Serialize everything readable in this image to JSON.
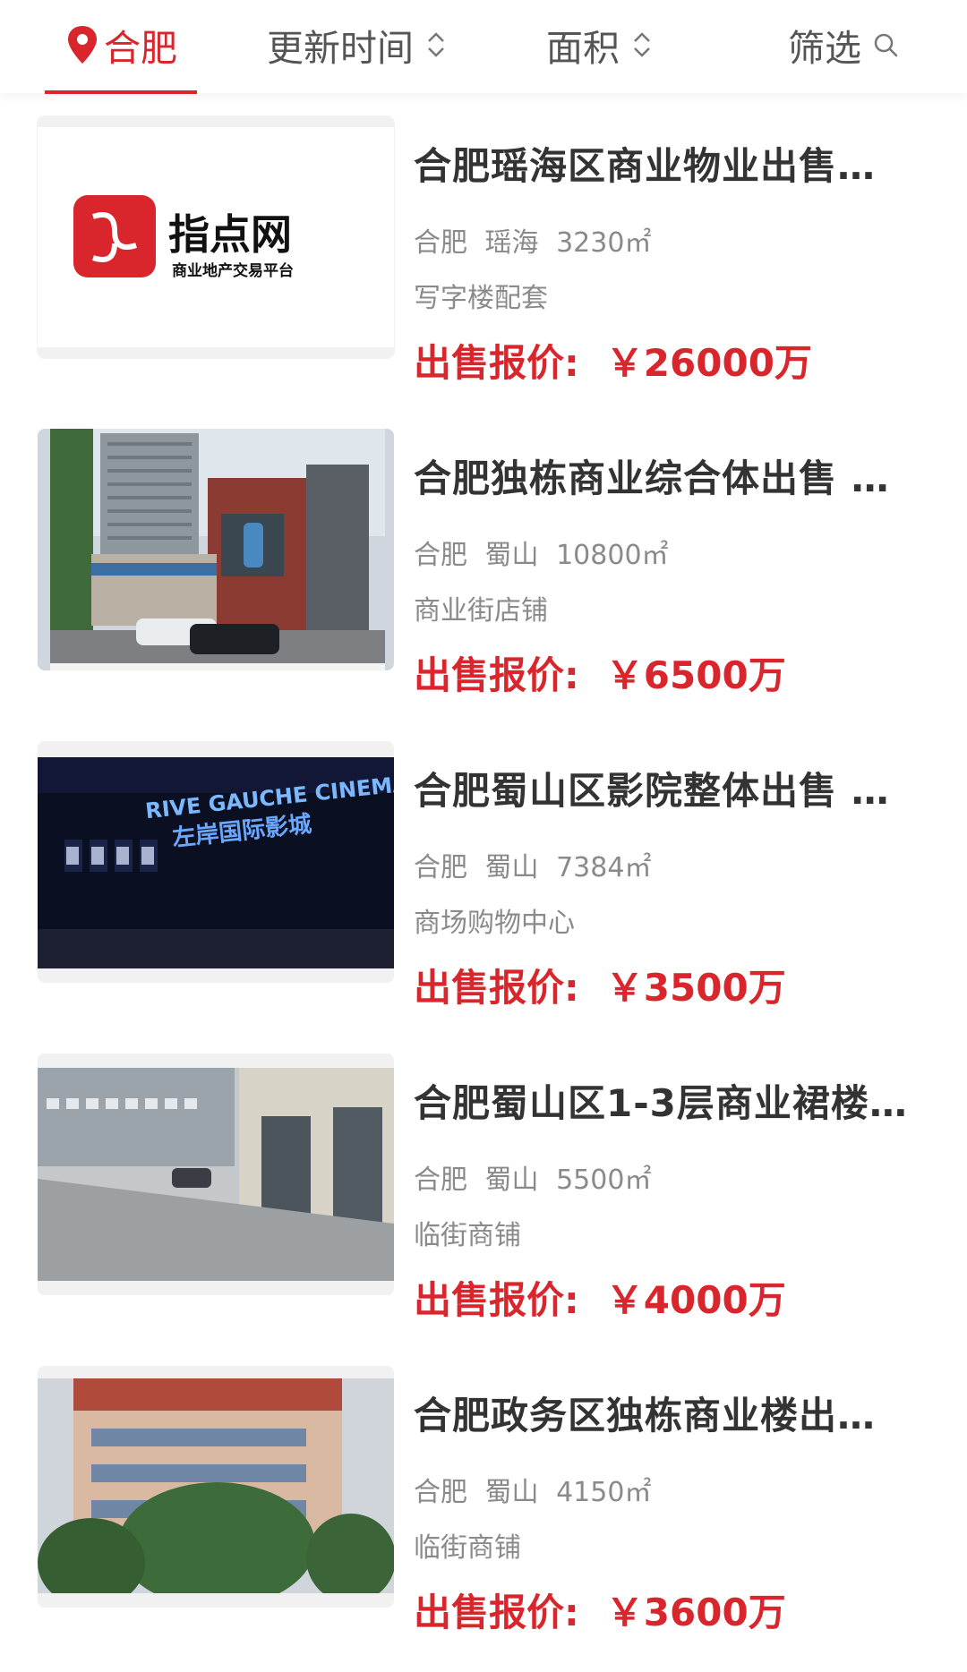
{
  "filter_bar": {
    "city": "合肥",
    "update_time": "更新时间",
    "area": "面积",
    "filter": "筛选"
  },
  "listings": [
    {
      "title": "合肥瑶海区商业物业出售…",
      "city": "合肥",
      "district": "瑶海",
      "area": "3230㎡",
      "category": "写字楼配套",
      "price_label": "出售报价:",
      "price": "￥26000万",
      "logo_name": "指点网",
      "logo_subtitle": "商业地产交易平台"
    },
    {
      "title": "合肥独栋商业综合体出售 …",
      "city": "合肥",
      "district": "蜀山",
      "area": "10800㎡",
      "category": "商业街店铺",
      "price_label": "出售报价:",
      "price": "￥6500万"
    },
    {
      "title": "合肥蜀山区影院整体出售 …",
      "city": "合肥",
      "district": "蜀山",
      "area": "7384㎡",
      "category": "商场购物中心",
      "price_label": "出售报价:",
      "price": "￥3500万",
      "sign_text": "RIVE GAUCHE CINEMAS",
      "sign_text_cn": "左岸国际影城"
    },
    {
      "title": "合肥蜀山区1-3层商业裙楼…",
      "city": "合肥",
      "district": "蜀山",
      "area": "5500㎡",
      "category": "临街商铺",
      "price_label": "出售报价:",
      "price": "￥4000万"
    },
    {
      "title": "合肥政务区独栋商业楼出…",
      "city": "合肥",
      "district": "蜀山",
      "area": "4150㎡",
      "category": "临街商铺",
      "price_label": "出售报价:",
      "price": "￥3600万"
    }
  ],
  "colors": {
    "accent": "#d8262c",
    "title": "#333333",
    "meta": "#8a8a8a"
  },
  "icons": {
    "city": "location-pin-icon",
    "sort": "sort-chevron-icon",
    "search": "search-icon"
  }
}
